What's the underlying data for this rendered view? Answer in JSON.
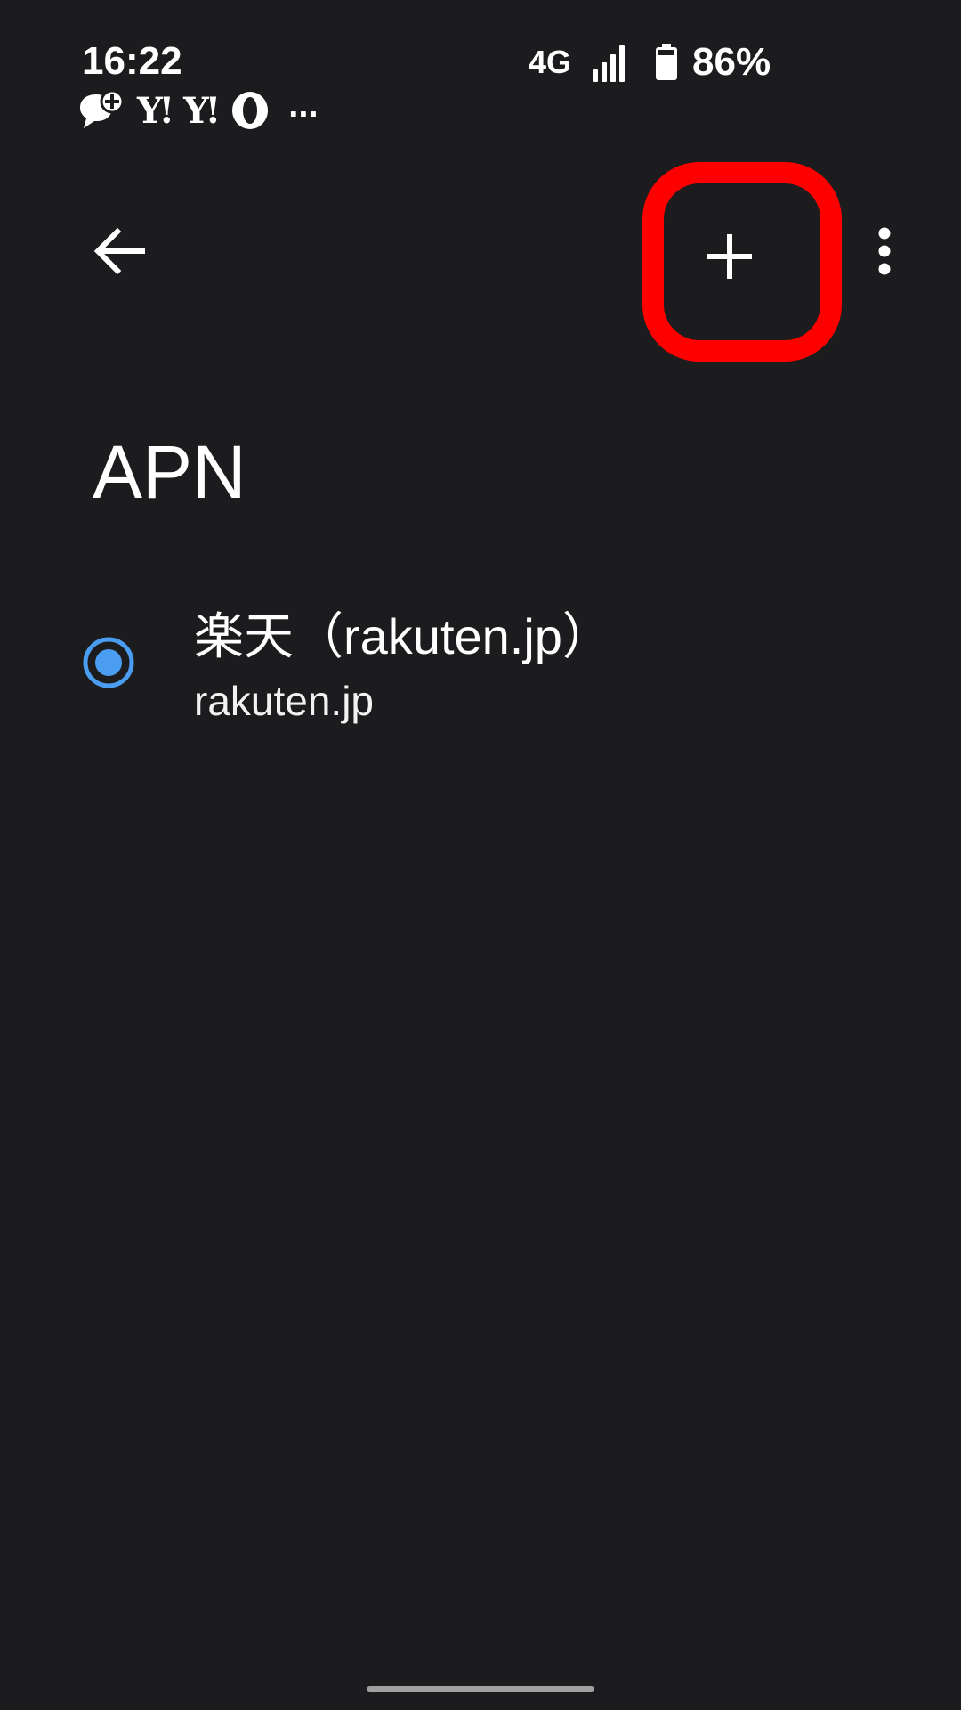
{
  "status_bar": {
    "time": "16:22",
    "network": "4G",
    "battery": "86%",
    "notifications": [
      {
        "icon": "chat-plus-icon"
      },
      {
        "icon": "yahoo-icon",
        "label": "Y!"
      },
      {
        "icon": "yahoo-icon",
        "label": "Y!"
      },
      {
        "icon": "opera-icon"
      }
    ],
    "more": "..."
  },
  "app_bar": {
    "back_icon": "arrow-back-icon",
    "add_icon": "plus-icon",
    "overflow_icon": "more-vert-icon",
    "highlight_color": "#ff0000"
  },
  "page": {
    "title": "APN"
  },
  "apn_list": [
    {
      "name": "楽天（rakuten.jp）",
      "apn": "rakuten.jp",
      "selected": true
    }
  ],
  "colors": {
    "background": "#1c1c1e",
    "accent": "#4a9df0",
    "text": "#ffffff"
  }
}
